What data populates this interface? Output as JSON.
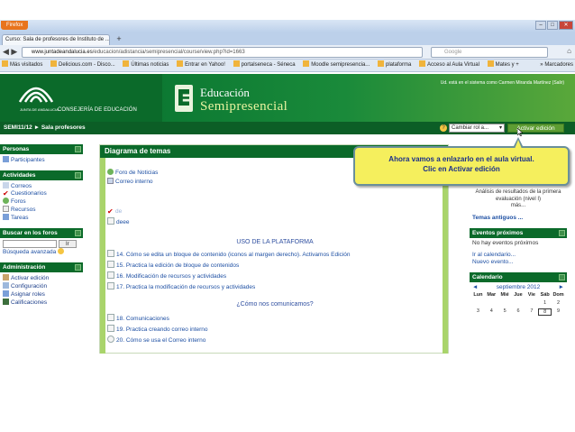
{
  "browser": {
    "firefox_button": "Firefox",
    "tab_title": "Curso: Sala de profesores de Instituto de ...",
    "url_domain": "www.juntadeandalucia.es",
    "url_path": "/educacion/adistancia/semipresencial/course/view.php?id=1663",
    "search_placeholder": "Google",
    "bookmarks": [
      "Más visitados",
      "Delicious.com - Disco...",
      "Últimas noticias",
      "Entrar en Yahoo!",
      "portalseneca - Séneca",
      "Moodle semipresencia...",
      "plataforma",
      "Acceso al Aula Virtual",
      "Mates y +"
    ],
    "bookmarks_more": "Marcadores"
  },
  "header": {
    "logo_caption": "JUNTA DE ANDALUCIA",
    "logo_text": "CONSEJERÍA DE EDUCACIÓN",
    "title": "Educación",
    "subtitle": "Semipresencial",
    "user_info": "Ud. está en el sistema como Carmen Miranda Martínez (Salir)"
  },
  "nav": {
    "breadcrumb": "SEMI11/12 ► Sala profesores",
    "role_select": "Cambiar rol a...",
    "edit_button": "Activar edición"
  },
  "left": {
    "personas": {
      "title": "Personas",
      "items": [
        "Participantes"
      ]
    },
    "actividades": {
      "title": "Actividades",
      "items": [
        "Correos",
        "Cuestionarios",
        "Foros",
        "Recursos",
        "Tareas"
      ]
    },
    "search": {
      "title": "Buscar en los foros",
      "button": "Ir",
      "link": "Búsqueda avanzada"
    },
    "admin": {
      "title": "Administración",
      "items": [
        "Activar edición",
        "Configuración",
        "Asignar roles",
        "Calificaciones"
      ]
    }
  },
  "center": {
    "title": "Diagrama de temas",
    "top_items": [
      "Foro de Noticias",
      "Correo interno"
    ],
    "misc_items": [
      "de",
      "deee"
    ],
    "section1_title": "USO DE LA PLATAFORMA",
    "section1_items": [
      "14. Cómo se edita un bloque de contenido (iconos al margen derecho). Activamos Edición",
      "15. Practica la edición de bloque de contenidos",
      "16. Modificación de recursos y actividades",
      "17. Practica la modificación de recursos y actividades"
    ],
    "section2_title": "¿Cómo nos comunicamos?",
    "section2_items": [
      "18. Comunicaciones",
      "19. Practica creando correo interno",
      "20. Cómo se usa el Correo interno"
    ]
  },
  "right": {
    "top_text": "Análisis de resultados de la primera evaluación (nivel I)",
    "top_more": "más...",
    "top_link": "Temas antiguos ...",
    "events": {
      "title": "Eventos próximos",
      "empty": "No hay eventos próximos",
      "calendar_link": "Ir al calendario...",
      "new_event": "Nuevo evento..."
    },
    "calendar": {
      "title": "Calendario",
      "month": "septiembre 2012",
      "prev": "◄",
      "next": "►",
      "days": [
        "Lun",
        "Mar",
        "Mié",
        "Jue",
        "Vie",
        "Sáb",
        "Dom"
      ],
      "row1": [
        "",
        "",
        "",
        "",
        "",
        "1",
        "2"
      ],
      "row2": [
        "3",
        "4",
        "5",
        "6",
        "7",
        "8",
        "9"
      ],
      "today": "8"
    }
  },
  "callout": {
    "line1": "Ahora vamos a enlazarlo en el aula virtual.",
    "line2": "Clic en Activar edición"
  }
}
